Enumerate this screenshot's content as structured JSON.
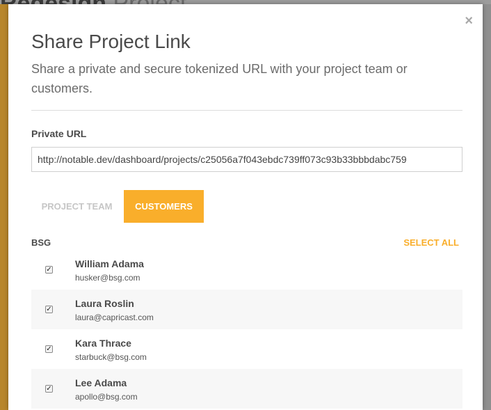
{
  "background": {
    "title_bold": "Redesign",
    "title_light": "Project"
  },
  "modal": {
    "close_symbol": "×",
    "title": "Share Project Link",
    "subtitle": "Share a private and secure tokenized URL with your project team or customers.",
    "private_url_label": "Private URL",
    "private_url_value": "http://notable.dev/dashboard/projects/c25056a7f043ebdc739ff073c93b33bbbdabc759",
    "tabs": [
      {
        "label": "PROJECT TEAM",
        "active": false
      },
      {
        "label": "CUSTOMERS",
        "active": true
      }
    ],
    "group_label": "BSG",
    "select_all_label": "SELECT ALL",
    "check_symbol": "✓",
    "customers": [
      {
        "name": "William Adama",
        "email": "husker@bsg.com",
        "checked": true
      },
      {
        "name": "Laura Roslin",
        "email": "laura@capricast.com",
        "checked": true
      },
      {
        "name": "Kara Thrace",
        "email": "starbuck@bsg.com",
        "checked": true
      },
      {
        "name": "Lee Adama",
        "email": "apollo@bsg.com",
        "checked": true
      }
    ]
  },
  "colors": {
    "accent": "#f9ae2b",
    "text_dark": "#4a4a4a",
    "tab_inactive": "#c6c6c6"
  },
  "icons": {
    "close": "close-icon",
    "checkbox": "checkbox-checked-icon"
  }
}
